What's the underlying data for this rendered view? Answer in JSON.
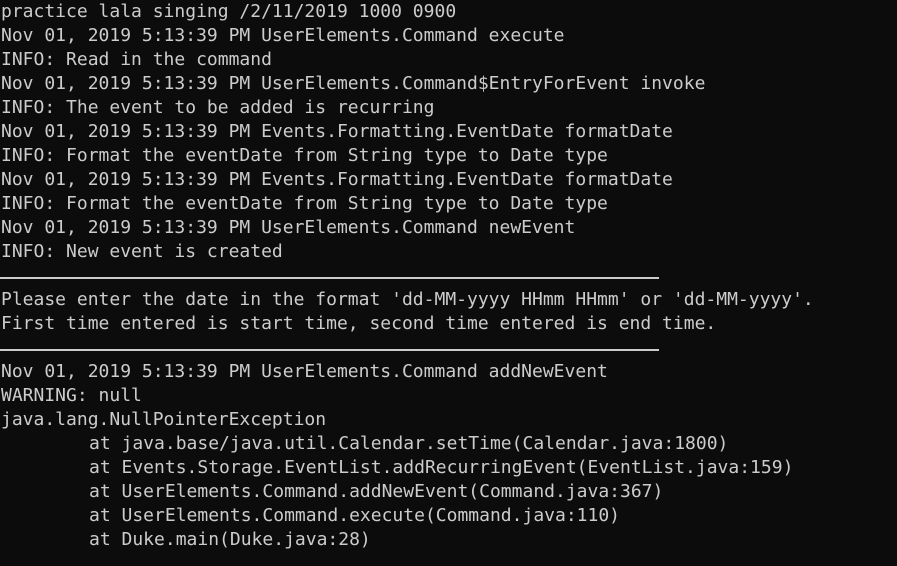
{
  "window": {
    "colors": {
      "background": "#0c0c0c",
      "text": "#cccccc"
    }
  },
  "console": {
    "header": "practice lala singing /2/11/2019 1000 0900",
    "log1_time": "Nov 01, 2019 5:13:39 PM UserElements.Command execute",
    "log1_msg": "INFO: Read in the command",
    "log2_time": "Nov 01, 2019 5:13:39 PM UserElements.Command$EntryForEvent invoke",
    "log2_msg": "INFO: The event to be added is recurring",
    "log3_time": "Nov 01, 2019 5:13:39 PM Events.Formatting.EventDate formatDate",
    "log3_msg": "INFO: Format the eventDate from String type to Date type",
    "log4_time": "Nov 01, 2019 5:13:39 PM Events.Formatting.EventDate formatDate",
    "log4_msg": "INFO: Format the eventDate from String type to Date type",
    "log5_time": "Nov 01, 2019 5:13:39 PM UserElements.Command newEvent",
    "log5_msg": "INFO: New event is created",
    "prompt_line1": "Please enter the date in the format 'dd-MM-yyyy HHmm HHmm' or 'dd-MM-yyyy'.",
    "prompt_line2": "First time entered is start time, second time entered is end time.",
    "warn_time": "Nov 01, 2019 5:13:39 PM UserElements.Command addNewEvent",
    "warn_msg": "WARNING: null",
    "exception": "java.lang.NullPointerException",
    "stack": [
      "at java.base/java.util.Calendar.setTime(Calendar.java:1800)",
      "at Events.Storage.EventList.addRecurringEvent(EventList.java:159)",
      "at UserElements.Command.addNewEvent(Command.java:367)",
      "at UserElements.Command.execute(Command.java:110)",
      "at Duke.main(Duke.java:28)"
    ]
  }
}
